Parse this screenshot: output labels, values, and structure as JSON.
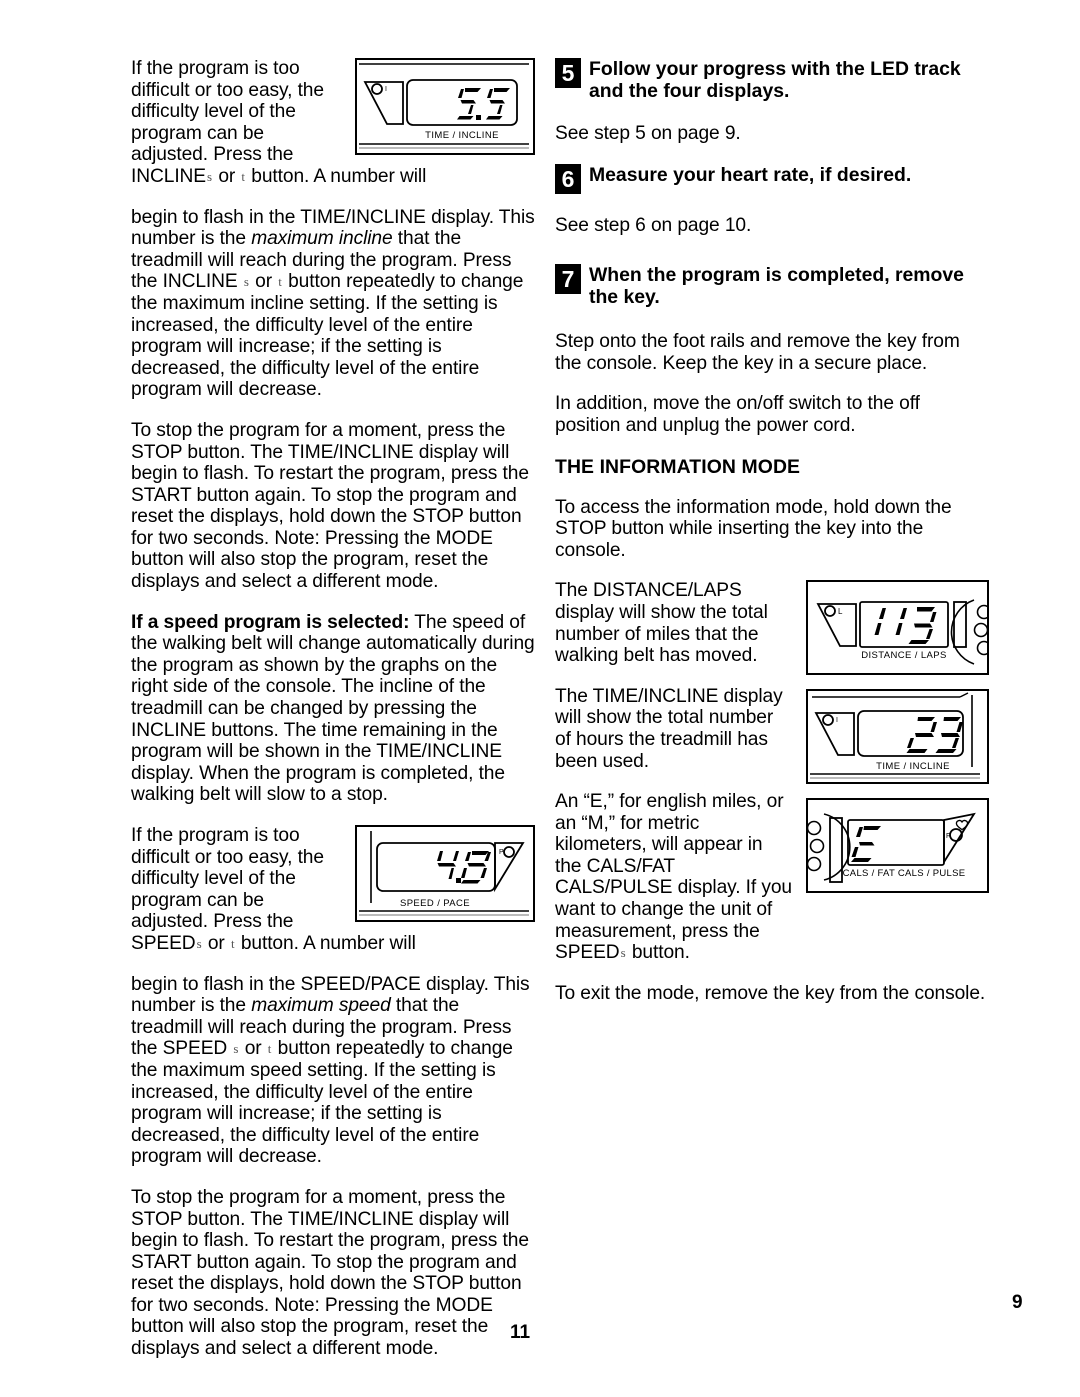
{
  "document": {
    "page_number_center": "11",
    "page_number_corner": "9"
  },
  "left_column": {
    "para_incline_intro": "If the program is too difficult or too easy, the difficulty level of the program can be adjusted. Press the INCLINE",
    "para_incline_intro_mid": "or",
    "para_incline_intro_end": "button. A number will",
    "para_incline_cont_1": "begin to flash in the TIME/INCLINE display. This number is the ",
    "para_incline_italic": "maximum incline",
    "para_incline_cont_2": " that the treadmill will reach during the program. Press the INCLINE",
    "para_incline_cont_3": "or",
    "para_incline_cont_4": "button repeatedly to change the maximum incline setting. If the setting is increased, the difficulty level of the entire program will increase; if the setting is decreased, the difficulty level of the entire program will decrease.",
    "para_stop_1": "To stop the program for a moment, press the STOP button. The TIME/INCLINE display will begin to flash. To restart the program, press the START button again. To stop the program and reset the displays, hold down the STOP button for two seconds. Note: Pressing the MODE button will also stop the program, reset the displays and select a different mode.",
    "para_speed_program_bold": "If a speed program is selected:",
    "para_speed_program_rest": " The speed of the walking belt will change automatically during the program as shown by the graphs on the right side of the console. The incline of the treadmill can be changed by pressing the INCLINE buttons. The time remaining in the program will be shown in the TIME/INCLINE display. When the program is completed, the walking belt will slow to a stop.",
    "para_speed_intro": "If the program is too difficult or too easy, the difficulty level of the program can be adjusted. Press the SPEED",
    "para_speed_intro_mid": "or",
    "para_speed_intro_end": "button. A number will",
    "para_speed_cont_1": "begin to flash in the SPEED/PACE display. This number is the ",
    "para_speed_italic": "maximum speed",
    "para_speed_cont_2": " that the treadmill will reach during the program. Press the SPEED",
    "para_speed_cont_3": "or",
    "para_speed_cont_4": "button repeatedly to change the maximum speed setting. If the setting is increased, the difficulty level of the entire program will increase; if the setting is decreased, the difficulty level of the entire program will decrease.",
    "para_stop_2": "To stop the program for a moment, press the STOP button. The TIME/INCLINE display will begin to flash. To restart the program, press the START button again. To stop the program and reset the displays, hold down the STOP button for two seconds. Note: Pressing the MODE button will also stop the program, reset the displays and select a different mode.",
    "figures": {
      "time_incline": {
        "value": "5.5",
        "label": "TIME / INCLINE"
      },
      "speed_pace": {
        "value": "4.8",
        "label": "SPEED / PACE"
      }
    }
  },
  "right_column": {
    "steps": [
      {
        "number": "5",
        "title": "Follow your progress with the LED track and the four displays.",
        "body": "See step 5 on page 9."
      },
      {
        "number": "6",
        "title": "Measure your heart rate, if desired.",
        "body": "See step 6 on page 10."
      },
      {
        "number": "7",
        "title": "When the program is completed, remove the key.",
        "body_1": "Step onto the foot rails and remove the key from the console. Keep the key in a secure place.",
        "body_2": "In addition, move the on/off switch to the off position and unplug the power cord."
      }
    ],
    "section_heading": "THE INFORMATION MODE",
    "para_access": "To access the information mode, hold down the STOP button while inserting the key into the console.",
    "para_distance": "The DISTANCE/LAPS display will show the total number of miles that the walking belt has moved.",
    "para_time": "The TIME/INCLINE display will show the total number of hours the treadmill has been used.",
    "para_cals_1": "An “E,” for english miles, or an “M,” for metric kilometers, will appear in the CALS/FAT CALS/PULSE display. If you want to change the unit of measurement, press the",
    "para_cals_speed": "SPEED",
    "para_cals_2": "button.",
    "para_exit": "To exit the mode, remove the key from the console.",
    "figures": {
      "distance_laps": {
        "value": "113",
        "label": "DISTANCE / LAPS",
        "indicator": "L"
      },
      "time_incline": {
        "value": "23",
        "label": "TIME / INCLINE",
        "indicator": "I"
      },
      "cals_fat": {
        "value": "E",
        "label": "CALS / FAT CALS / PULSE",
        "indicator": "F"
      }
    }
  },
  "symbols": {
    "arrow_up": "s",
    "arrow_down": "t"
  }
}
